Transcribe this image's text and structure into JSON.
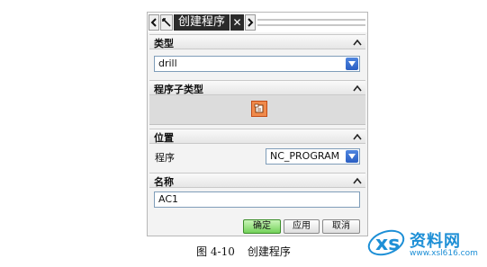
{
  "dialog": {
    "title": "创建程序",
    "close_glyph": "✕"
  },
  "sections": {
    "type": {
      "label": "类型",
      "value": "drill"
    },
    "subtype": {
      "label": "程序子类型",
      "icon": "program-subtype-icon"
    },
    "location": {
      "label": "位置",
      "program_label": "程序",
      "program_value": "NC_PROGRAM"
    },
    "name": {
      "label": "名称",
      "value": "AC1"
    }
  },
  "buttons": {
    "ok": "确定",
    "apply": "应用",
    "cancel": "取消"
  },
  "caption": {
    "figure": "图 4-10",
    "text": "创建程序"
  },
  "watermark": {
    "text": "资料网",
    "url": "www.xsl616.com"
  },
  "colors": {
    "ok_button": "#74d25a",
    "dropdown_arrow": "#2a5ec2",
    "watermark": "#1d8fd6",
    "subtype_icon": "#f08a4b"
  }
}
